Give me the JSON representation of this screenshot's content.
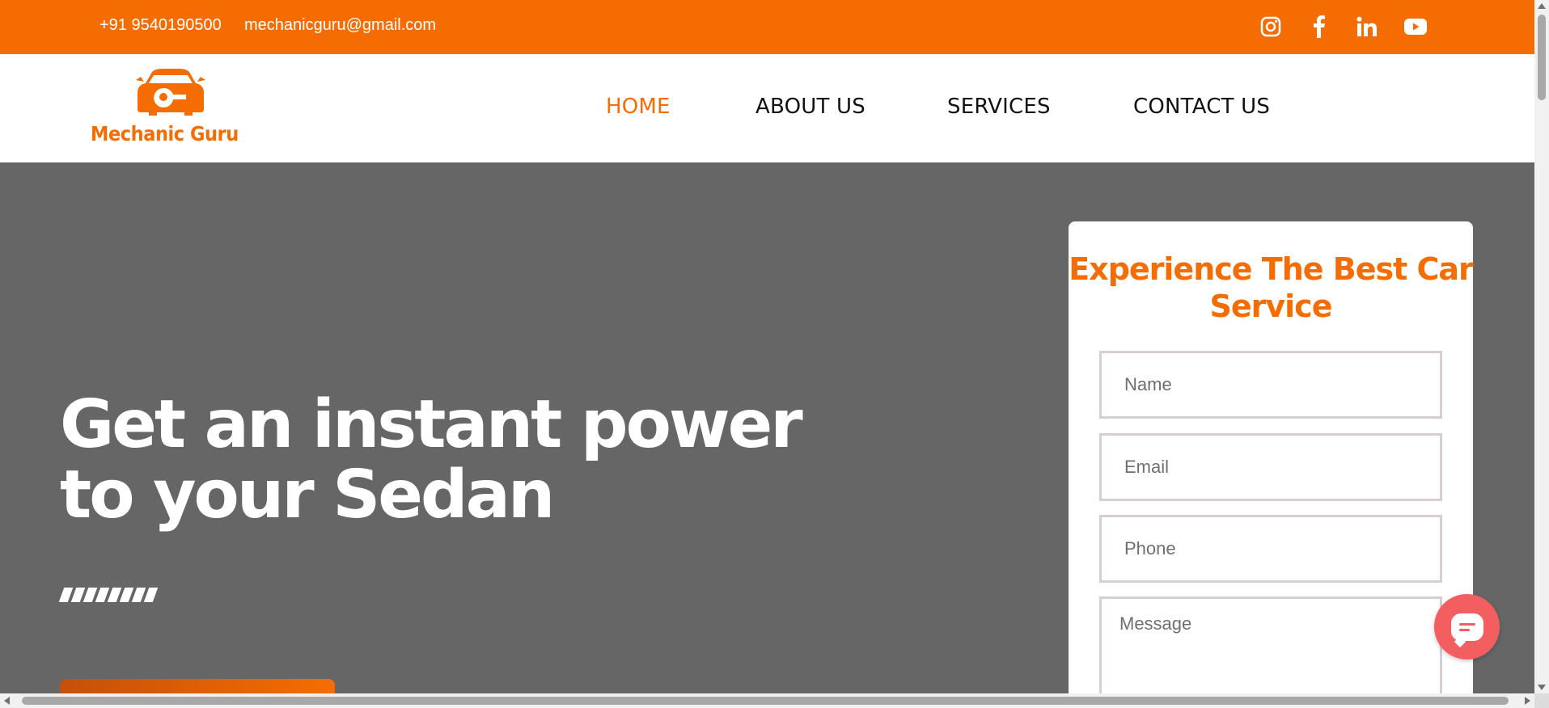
{
  "topbar": {
    "phone": "+91 9540190500",
    "email": "mechanicguru@gmail.com",
    "social": [
      "instagram-icon",
      "facebook-icon",
      "linkedin-icon",
      "youtube-icon"
    ]
  },
  "brand": {
    "name": "Mechanic Guru",
    "logo_icon": "car-wrench-icon"
  },
  "nav": {
    "items": [
      {
        "label": "HOME",
        "active": true
      },
      {
        "label": "ABOUT US",
        "active": false
      },
      {
        "label": "SERVICES",
        "active": false
      },
      {
        "label": "CONTACT US",
        "active": false
      }
    ]
  },
  "hero": {
    "title": "Get an instant power to your Sedan"
  },
  "form": {
    "title": "Experience The Best Car Service",
    "name_placeholder": "Name",
    "email_placeholder": "Email",
    "phone_placeholder": "Phone",
    "message_placeholder": "Message"
  },
  "chat": {
    "icon": "chat-bubble-icon"
  },
  "colors": {
    "accent": "#f56d02",
    "hero_bg": "#666666",
    "chat": "#f35e60"
  }
}
